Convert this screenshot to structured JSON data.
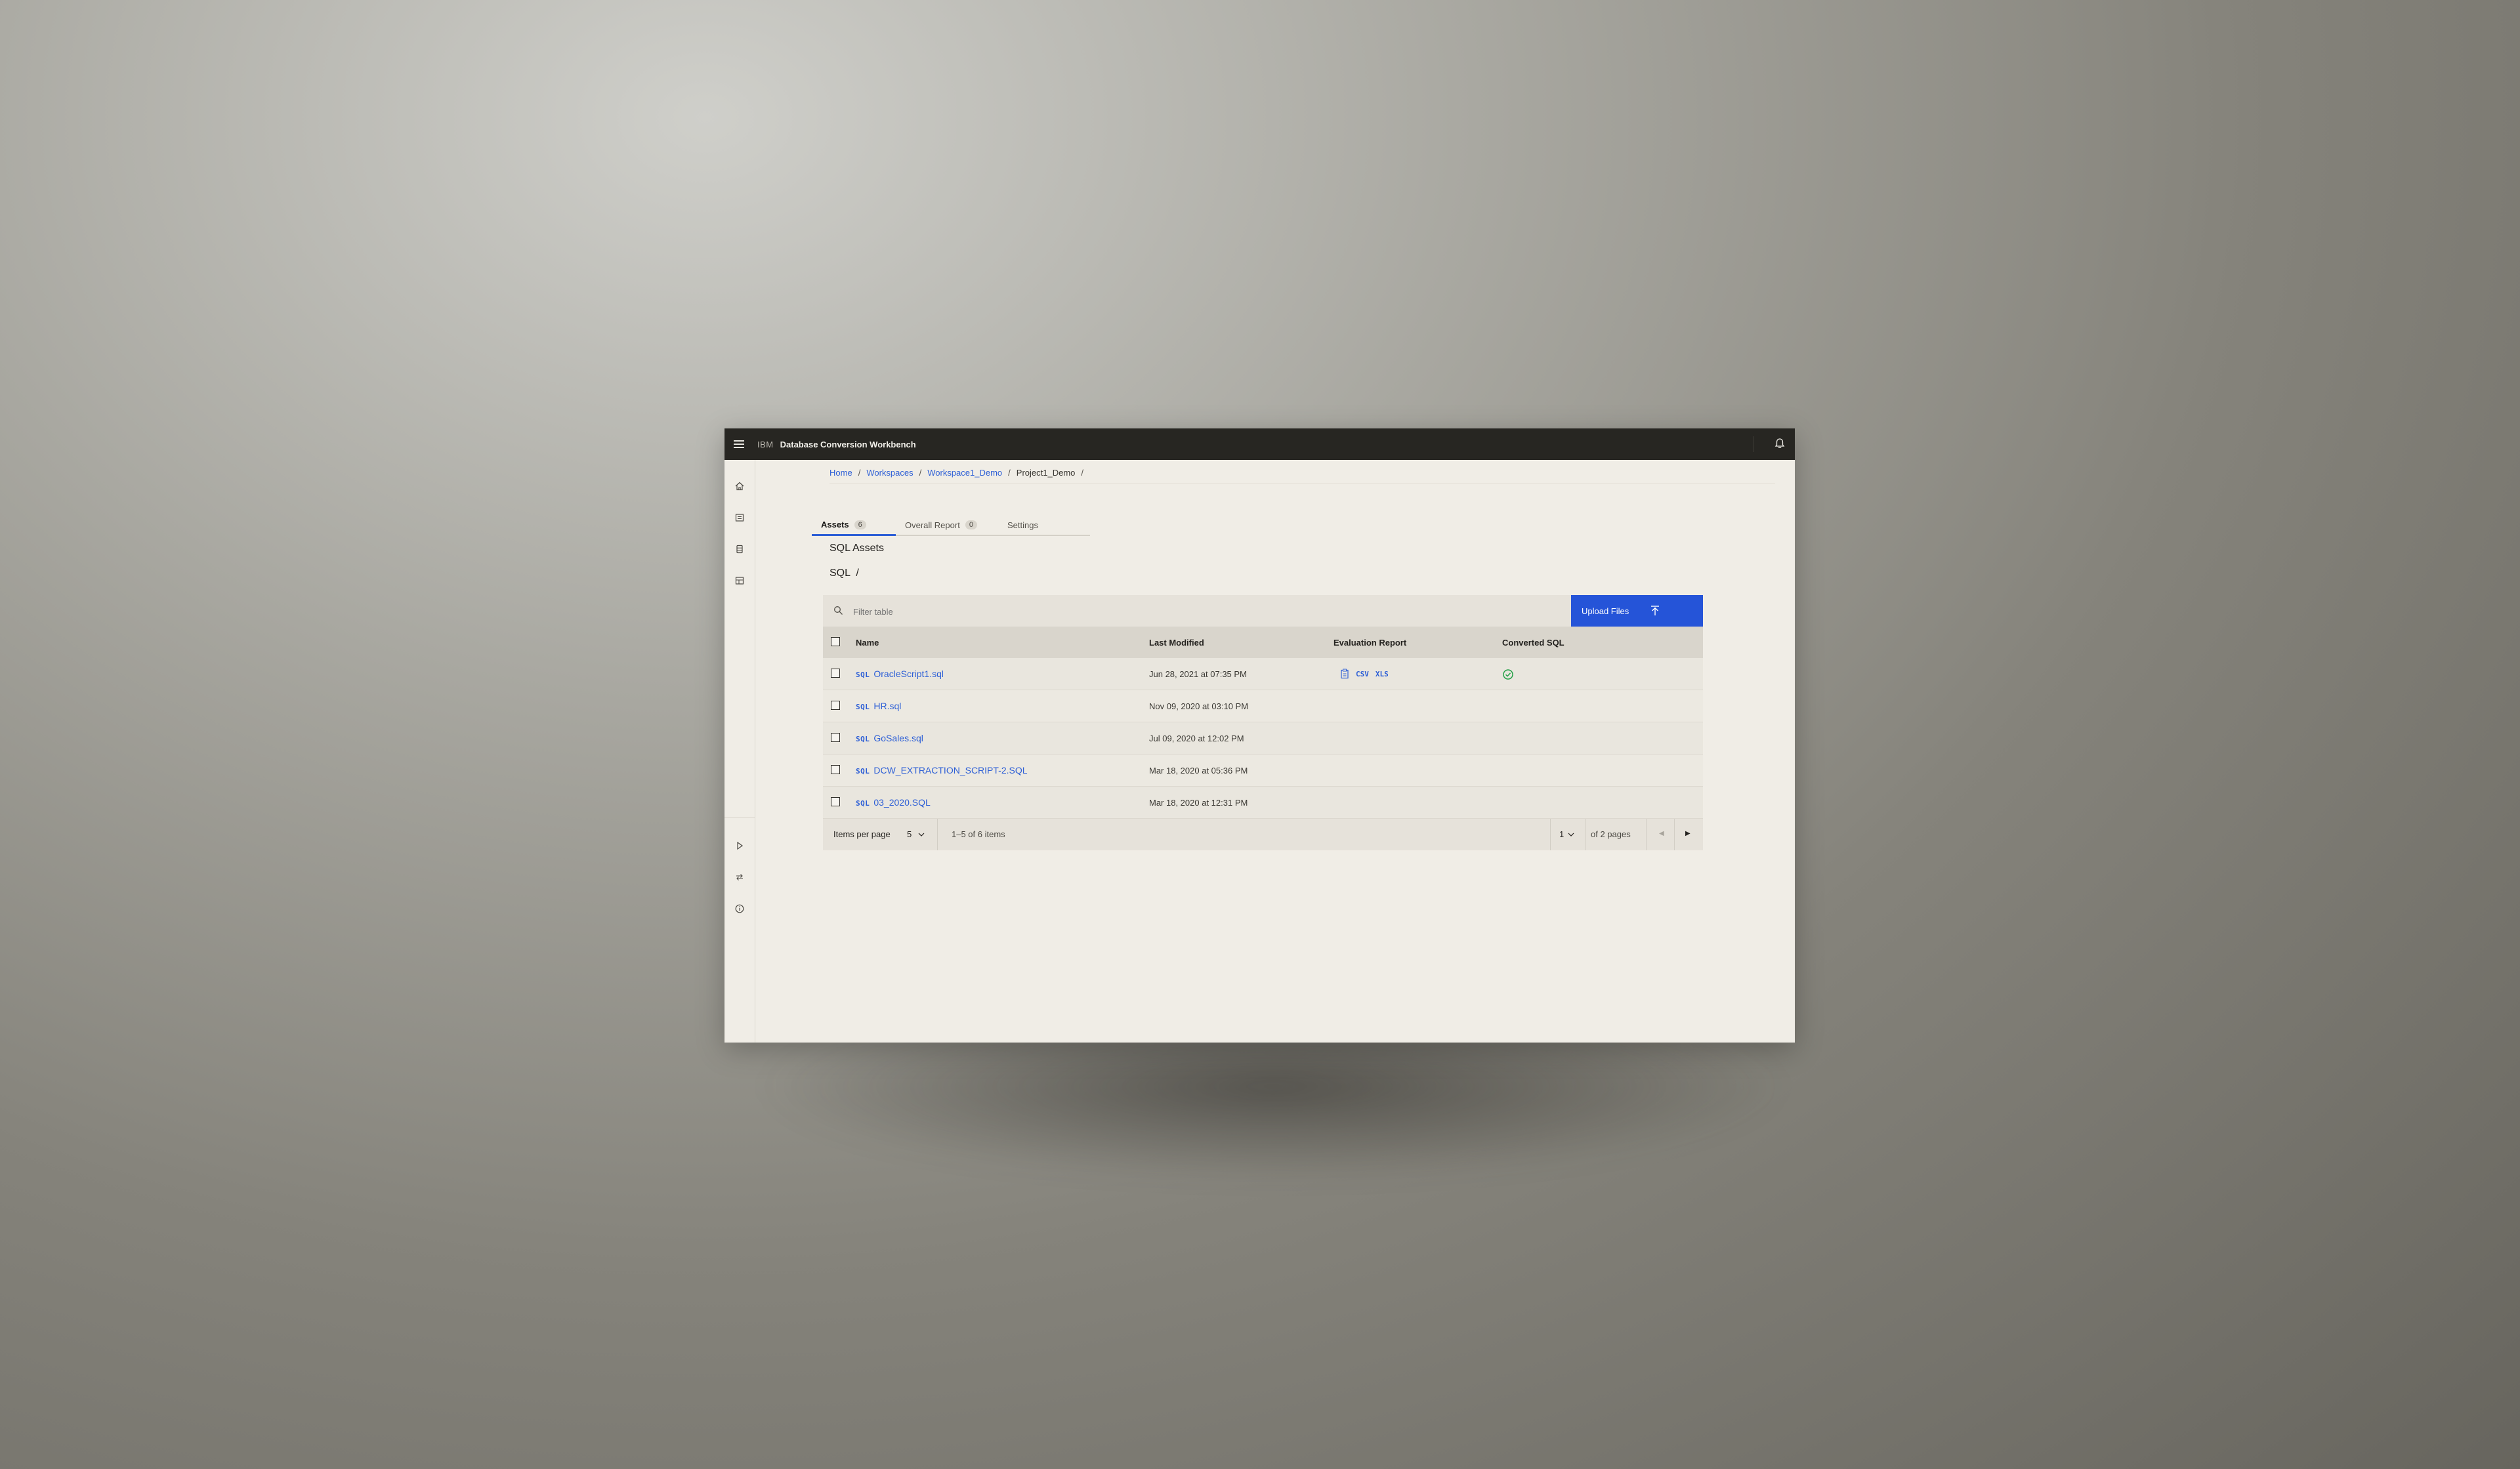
{
  "header": {
    "brand": "IBM",
    "app_name": "Database Conversion Workbench"
  },
  "breadcrumb": {
    "items": [
      "Home",
      "Workspaces",
      "Workspace1_Demo"
    ],
    "current": "Project1_Demo",
    "separator": "/"
  },
  "tabs": [
    {
      "label": "Assets",
      "count": "6"
    },
    {
      "label": "Overall Report",
      "count": "0"
    },
    {
      "label": "Settings"
    }
  ],
  "section": {
    "title": "SQL Assets",
    "path": "SQL  /"
  },
  "toolbar": {
    "filter_placeholder": "Filter table",
    "upload_label": "Upload Files"
  },
  "table": {
    "columns": [
      "Name",
      "Last Modified",
      "Evaluation Report",
      "Converted SQL"
    ],
    "sql_tag": "SQL",
    "rows": [
      {
        "name": "OracleScript1.sql",
        "modified": "Jun 28, 2021 at 07:35 PM",
        "eval_formats": [
          "CSV",
          "XLS"
        ],
        "converted": true
      },
      {
        "name": "HR.sql",
        "modified": "Nov 09, 2020 at 03:10 PM"
      },
      {
        "name": "GoSales.sql",
        "modified": "Jul 09, 2020 at 12:02 PM"
      },
      {
        "name": "DCW_EXTRACTION_SCRIPT-2.SQL",
        "modified": "Mar 18, 2020 at 05:36 PM"
      },
      {
        "name": "03_2020.SQL",
        "modified": "Mar 18, 2020 at 12:31 PM"
      }
    ]
  },
  "pagination": {
    "items_per_page_label": "Items per page",
    "items_per_page": "5",
    "range": "1–5 of 6 items",
    "current_page": "1",
    "of_pages": "of 2 pages"
  },
  "colors": {
    "accent": "#2554d8",
    "header_bg": "#272622",
    "success": "#24a148"
  }
}
